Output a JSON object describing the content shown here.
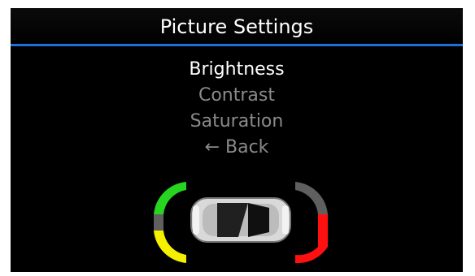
{
  "header": {
    "title": "Picture Settings"
  },
  "menu": {
    "items": [
      {
        "label": "Brightness",
        "selected": true
      },
      {
        "label": "Contrast",
        "selected": false
      },
      {
        "label": "Saturation",
        "selected": false
      },
      {
        "label": "← Back",
        "selected": false
      }
    ]
  },
  "parking_sensor": {
    "front_left": "green",
    "front_right": "red",
    "rear_left": "yellow",
    "rear_right": "red",
    "colors": {
      "green": "#27d41f",
      "yellow": "#f4f000",
      "red": "#ff1010",
      "gray": "#5f5f5f"
    }
  }
}
